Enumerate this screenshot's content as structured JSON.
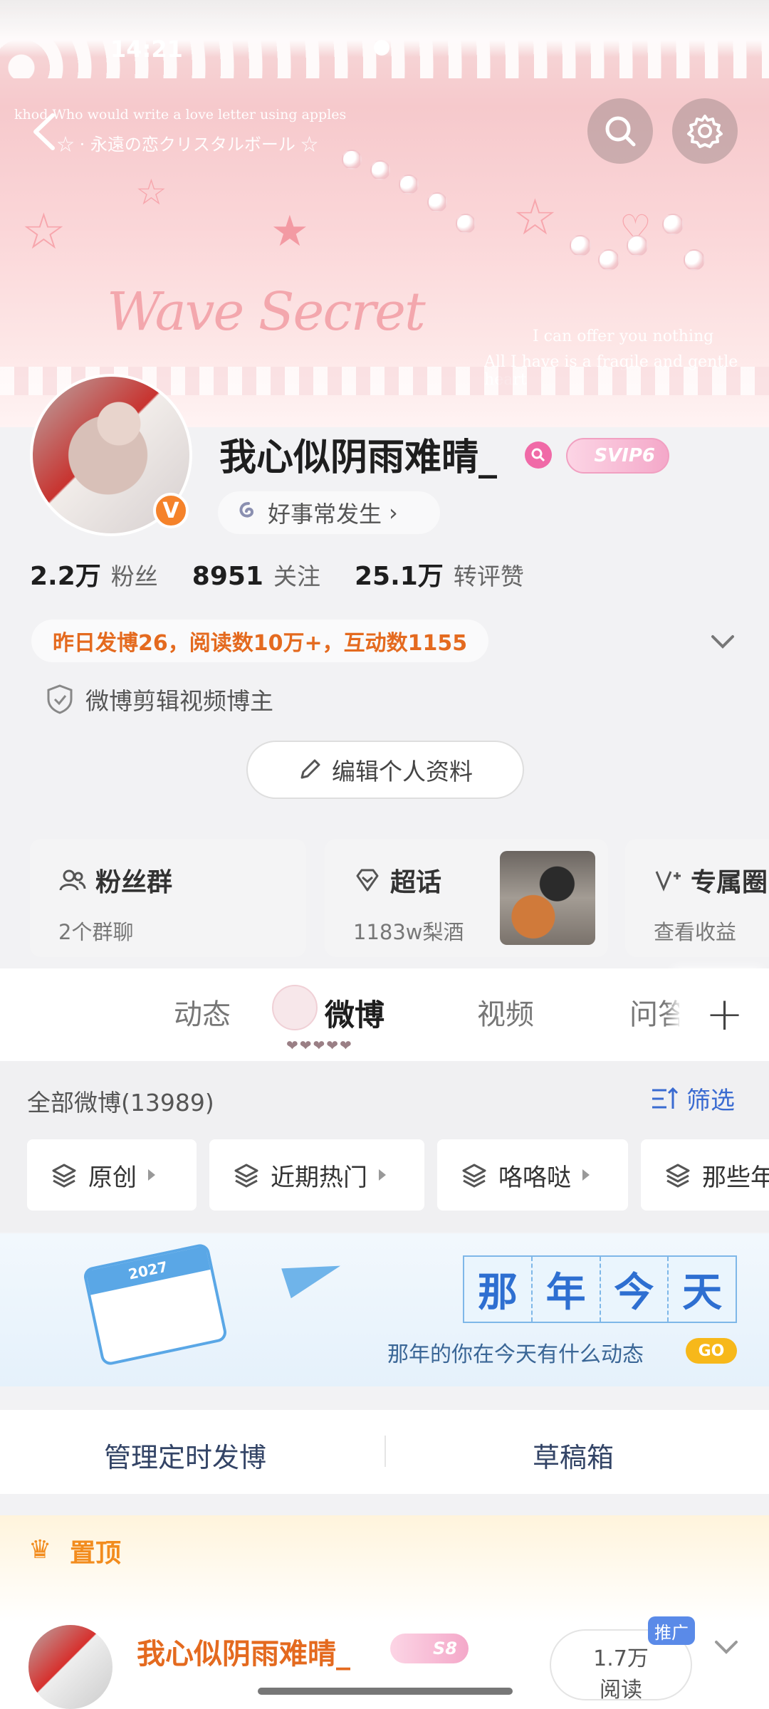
{
  "status": {
    "time": "14:21"
  },
  "banner": {
    "line1": "khod Who would write a love letter using apples",
    "line2": "☆ · 永遠の恋クリスタルボール ☆",
    "brand": "Wave Secret",
    "quote1": "I can offer you nothing",
    "quote2": "All I have is a fragile and gentle heart"
  },
  "profile": {
    "username": "我心似阴雨难晴_",
    "badge": "V",
    "vip": "SVIP6",
    "tag": "好事常发生",
    "stats": [
      {
        "value": "2.2万",
        "label": "粉丝"
      },
      {
        "value": "8951",
        "label": "关注"
      },
      {
        "value": "25.1万",
        "label": "转评赞"
      }
    ],
    "yesterday": "昨日发博26，阅读数10万+，互动数1155",
    "certification": "微博剪辑视频博主",
    "edit_label": "编辑个人资料"
  },
  "cards": [
    {
      "title": "粉丝群",
      "subtitle": "2个群聊",
      "icon": "group-icon"
    },
    {
      "title": "超话",
      "subtitle": "1183w梨酒",
      "icon": "diamond-icon"
    },
    {
      "title": "专属圈",
      "subtitle": "查看收益",
      "icon": "v-plus-icon"
    }
  ],
  "tabs": [
    "动态",
    "微博",
    "视频",
    "问答"
  ],
  "tab_hearts": "❤❤❤❤❤",
  "filter": {
    "all": "全部微博(13989)",
    "button": "筛选",
    "chips": [
      "原创",
      "近期热门",
      "咯咯哒",
      "那些年"
    ]
  },
  "memory": {
    "year": "2027",
    "title": [
      "那",
      "年",
      "今",
      "天"
    ],
    "subtitle": "那年的你在今天有什么动态",
    "go": "GO"
  },
  "actions": {
    "scheduled": "管理定时发博",
    "drafts": "草稿箱"
  },
  "pinned": {
    "label": "置顶",
    "name": "我心似阴雨难晴_",
    "vip": "S8",
    "reads_value": "1.7万",
    "reads_label": "阅读",
    "promo": "推广"
  },
  "colors": {
    "accent": "#f28c1e",
    "link": "#3a6bd1",
    "vip": "#f4a8c9"
  }
}
